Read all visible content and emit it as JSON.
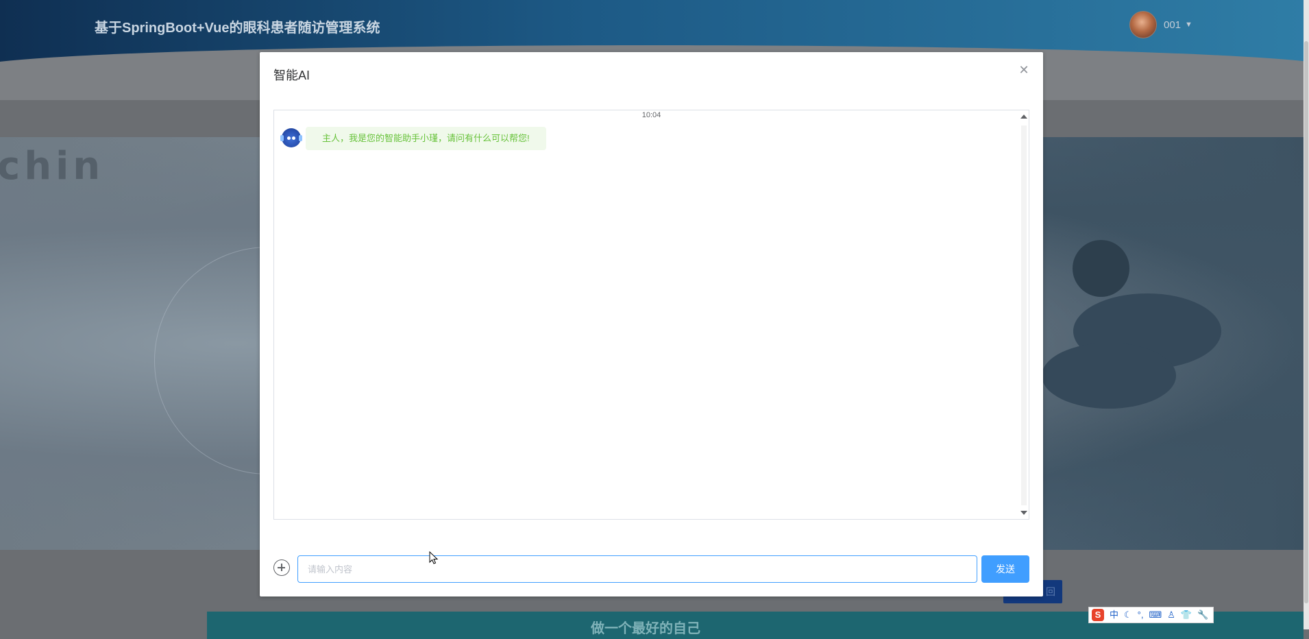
{
  "app": {
    "title": "基于SpringBoot+Vue的眼科患者随访管理系统",
    "user": {
      "name": "001"
    }
  },
  "background": {
    "banner_word": "chin",
    "banner_button_label": "回",
    "footer_text": "做一个最好的自己"
  },
  "dialog": {
    "title": "智能AI",
    "close_icon": "close-icon",
    "chat": {
      "time": "10:04",
      "messages": [
        {
          "sender": "bot",
          "avatar": "robot-icon",
          "text": "主人，我是您的智能助手小瑾，请问有什么可以帮您!"
        }
      ]
    },
    "input": {
      "placeholder": "请输入内容",
      "value": ""
    },
    "send_label": "发送",
    "add_icon": "plus-circle-icon"
  },
  "ime_toolbar": {
    "logo": "S",
    "items": [
      "中",
      "☾",
      "°,",
      "⌨",
      "♙",
      "👕",
      "🔧"
    ]
  },
  "colors": {
    "primary": "#409eff",
    "bubble_bg": "#f0f9eb",
    "bubble_text": "#67c23a",
    "header_dark": "#0f2f52"
  }
}
